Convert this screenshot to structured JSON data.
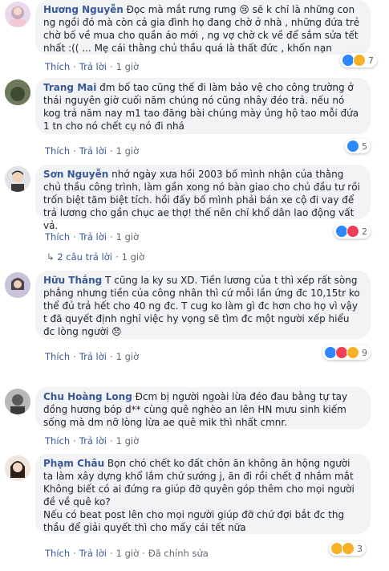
{
  "comments": [
    {
      "author": "Hương Nguyễn",
      "text": " Đọc mà mắt rưng rưng 😢 sẽ k chỉ là những con ng ngồi đó mà còn cả gia đình họ đang chờ ở nhà , những đứa trẻ chờ bố về mua cho quần áo mới , ng vợ chờ ck về để sắm sửa tết nhất :(( ... Mẹ cái thằng chủ thầu quá là thất đức , khốn nạn",
      "like": "Thích",
      "reply": "Trả lời",
      "time": "1 giờ",
      "reaction_count": "7",
      "reactions": [
        "like",
        "haha"
      ]
    },
    {
      "author": "Trang Mai",
      "text": " đm bố tao cũng thế đi làm bảo vệ cho công trường ở thái nguyên giờ cuối năm chúng nó cũng nhây đéo trả. nếu nó kog trả năm nay m1 tao đăng bài chúng mày ủng hộ tao mỗi đứa 1 tn cho nó chết cụ nó đi nhá",
      "like": "Thích",
      "reply": "Trả lời",
      "time": "1 giờ",
      "reaction_count": "5",
      "reactions": [
        "like"
      ]
    },
    {
      "author": "Sơn Nguyễn",
      "text": " nhớ ngày xưa hồi 2003 bố mình nhận của thằng chủ thầu công trình, làm gần xong nó bàn giao cho chủ đầu tư rồi trốn biệt tăm biệt tích. hồi đấy bố mình phải bán xe cộ đi vay để trả lương cho gần chục ae thợ! thế nên chỉ khổ dân lao động vất vả.",
      "like": "Thích",
      "reply": "Trả lời",
      "time": "1 giờ",
      "reaction_count": "2",
      "reactions": [
        "like",
        "love"
      ],
      "replies_label": "2 câu trả lời",
      "replies_time": "1 giờ"
    },
    {
      "author": "Hữu Thắng",
      "text": " T cũng la ky su XD. Tiền lương của t thì xếp rất sòng phẳng nhưng tiền của công nhân thì cứ mỗi lần ứng đc 10,15tr ko thể đủ trả hết cho 40 ng đc. T cug ko làm gì đc hơn cho họ vì vậy t đã quyết định nghỉ việc hy vọng sẽ tìm đc một người xếp hiểu đc lòng người 😞",
      "like": "Thích",
      "reply": "Trả lời",
      "time": "1 giờ",
      "reaction_count": "9",
      "reactions": [
        "like",
        "love",
        "wow"
      ]
    },
    {
      "author": "Chu Hoàng Long",
      "text": " Đcm bị người ngoài lừa đéo đau bằng tự tay đồng hương bóp d** cùng quê nghèo an lên HN mưu sinh kiếm sống mà dm nỡ lòng lừa ae quê mik thì nhất cmnr.",
      "like": "Thích",
      "reply": "Trả lời",
      "time": "1 giờ"
    },
    {
      "author": "Phạm Châu",
      "text": " Bọn chó chết ko đất chôn ăn không ăn hộng người ta làm xây dựng khổ lắm chứ sướng j, ăn đi rồi chết đ nhắm mắt Không biết có ai đứng ra giúp đỡ quyên góp thêm cho mọi người đề về quê ko?",
      "text2": "Nếu có beat post lên cho mọi người giúp đỡ chứ đợi bắt đc thg thầu để giải quyết thì cho mấy cái tết nữa",
      "like": "Thích",
      "reply": "Trả lời",
      "time": "1 giờ",
      "edited": "Đã chỉnh sửa",
      "reaction_count": "3",
      "reactions": [
        "sad",
        "haha"
      ]
    }
  ]
}
